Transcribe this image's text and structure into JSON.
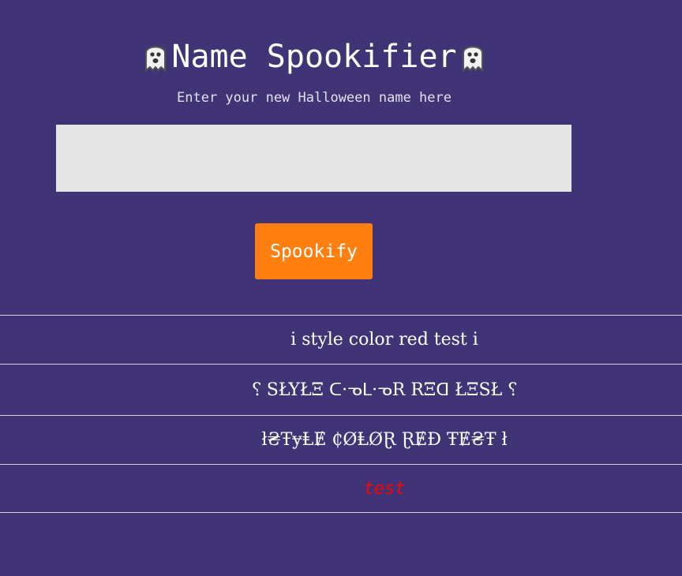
{
  "header": {
    "title": "Name Spookifier",
    "subtitle": "Enter your new Halloween name here",
    "left_icon": "ghost-icon",
    "right_icon": "ghost-icon"
  },
  "form": {
    "name_value": "",
    "submit_label": "Spookify"
  },
  "results": [
    {
      "text": "i style color red test i"
    },
    {
      "text": "⸮ SŁYŁΞ ᑕ·ᓀᒪ·ᓀR RΞᗡ ŁΞSŁ ⸮"
    },
    {
      "text": "ł₴ŦɏⱠɆ ₵ØⱠØⱤ ⱤɆĐ ŦɆ₴Ŧ ł"
    },
    {
      "text": "test",
      "color": "#ff0000"
    }
  ],
  "colors": {
    "background": "#413476",
    "input_bg": "#e5e5e5",
    "button_bg": "#ff7f11",
    "divider": "#d8d4e6",
    "result_red": "#ff0000"
  }
}
